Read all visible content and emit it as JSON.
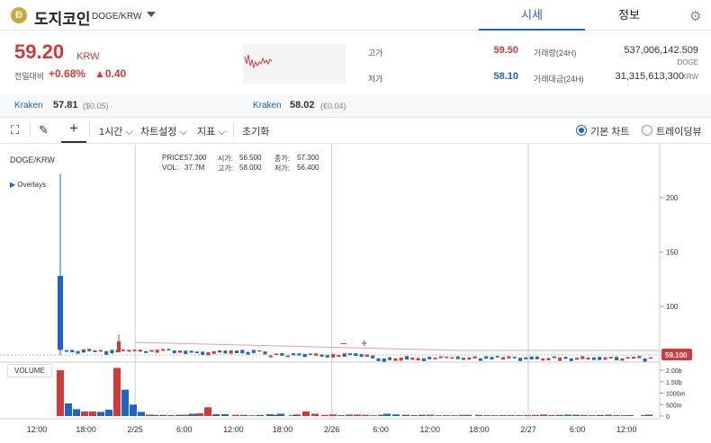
{
  "header": {
    "coin_icon_letter": "Ð",
    "coin_name": "도지코인",
    "pair": "DOGE/KRW",
    "tabs": [
      "시세",
      "정보"
    ]
  },
  "quote": {
    "price": "59.20",
    "unit": "KRW",
    "prev_label": "전일대비",
    "change_pct": "+0.68%",
    "change_abs": "▲0.40",
    "high_label": "고가",
    "high": "59.50",
    "low_label": "저가",
    "low": "58.10",
    "volume_label": "거래량(24H)",
    "volume": "537,006,142.509",
    "volume_unit": "DOGE",
    "amount_label": "거래대금(24H)",
    "amount": "31,315,613,300",
    "amount_unit": "KRW"
  },
  "exchanges": [
    {
      "name": "Kraken",
      "price": "57.81",
      "diff": "($0.05)"
    },
    {
      "name": "Kraken",
      "price": "58.02",
      "diff": "(€0.04)"
    }
  ],
  "toolbar": {
    "interval": "1시간",
    "chart_settings": "차트설정",
    "indicators": "지표",
    "reset": "초기화",
    "basic_chart": "기본 차트",
    "trading_view": "트레이딩뷰"
  },
  "colors": {
    "up": "#d23a3a",
    "down": "#1d63c8",
    "accent": "#1d63c8",
    "coin": "#c9a938"
  },
  "chart_data": {
    "type": "candlestick",
    "symbol": "DOGE/KRW",
    "overlays_label": "Overlays",
    "info": {
      "price_label": "PRICE:",
      "price": "57.300",
      "vol_label": "VOL:",
      "vol": "37.7M",
      "open_label": "시가:",
      "open": "56.500",
      "high_label": "고가:",
      "high": "58.000",
      "close_label": "종가:",
      "close": "57.300",
      "low_label": "저가:",
      "low": "56.400"
    },
    "last_price_tag": "59.100",
    "y_ticks": [
      100,
      150,
      200
    ],
    "ylim": [
      50,
      215
    ],
    "volume_label": "VOLUME",
    "volume_ticks": [
      "2.00b",
      "1.50b",
      "1000m",
      "500m",
      "0"
    ],
    "x_labels": [
      "12:00",
      "18:00",
      "2/25",
      "6:00",
      "12:00",
      "18:00",
      "2/26",
      "6:00",
      "12:00",
      "18:00",
      "2/27",
      "6:00",
      "12:00"
    ],
    "spike": {
      "open": 128,
      "high": 222,
      "low": 55,
      "close": 60
    },
    "volume_peaks": {
      "spike": 2.0,
      "second": 2.1,
      "third": 1.15
    }
  }
}
